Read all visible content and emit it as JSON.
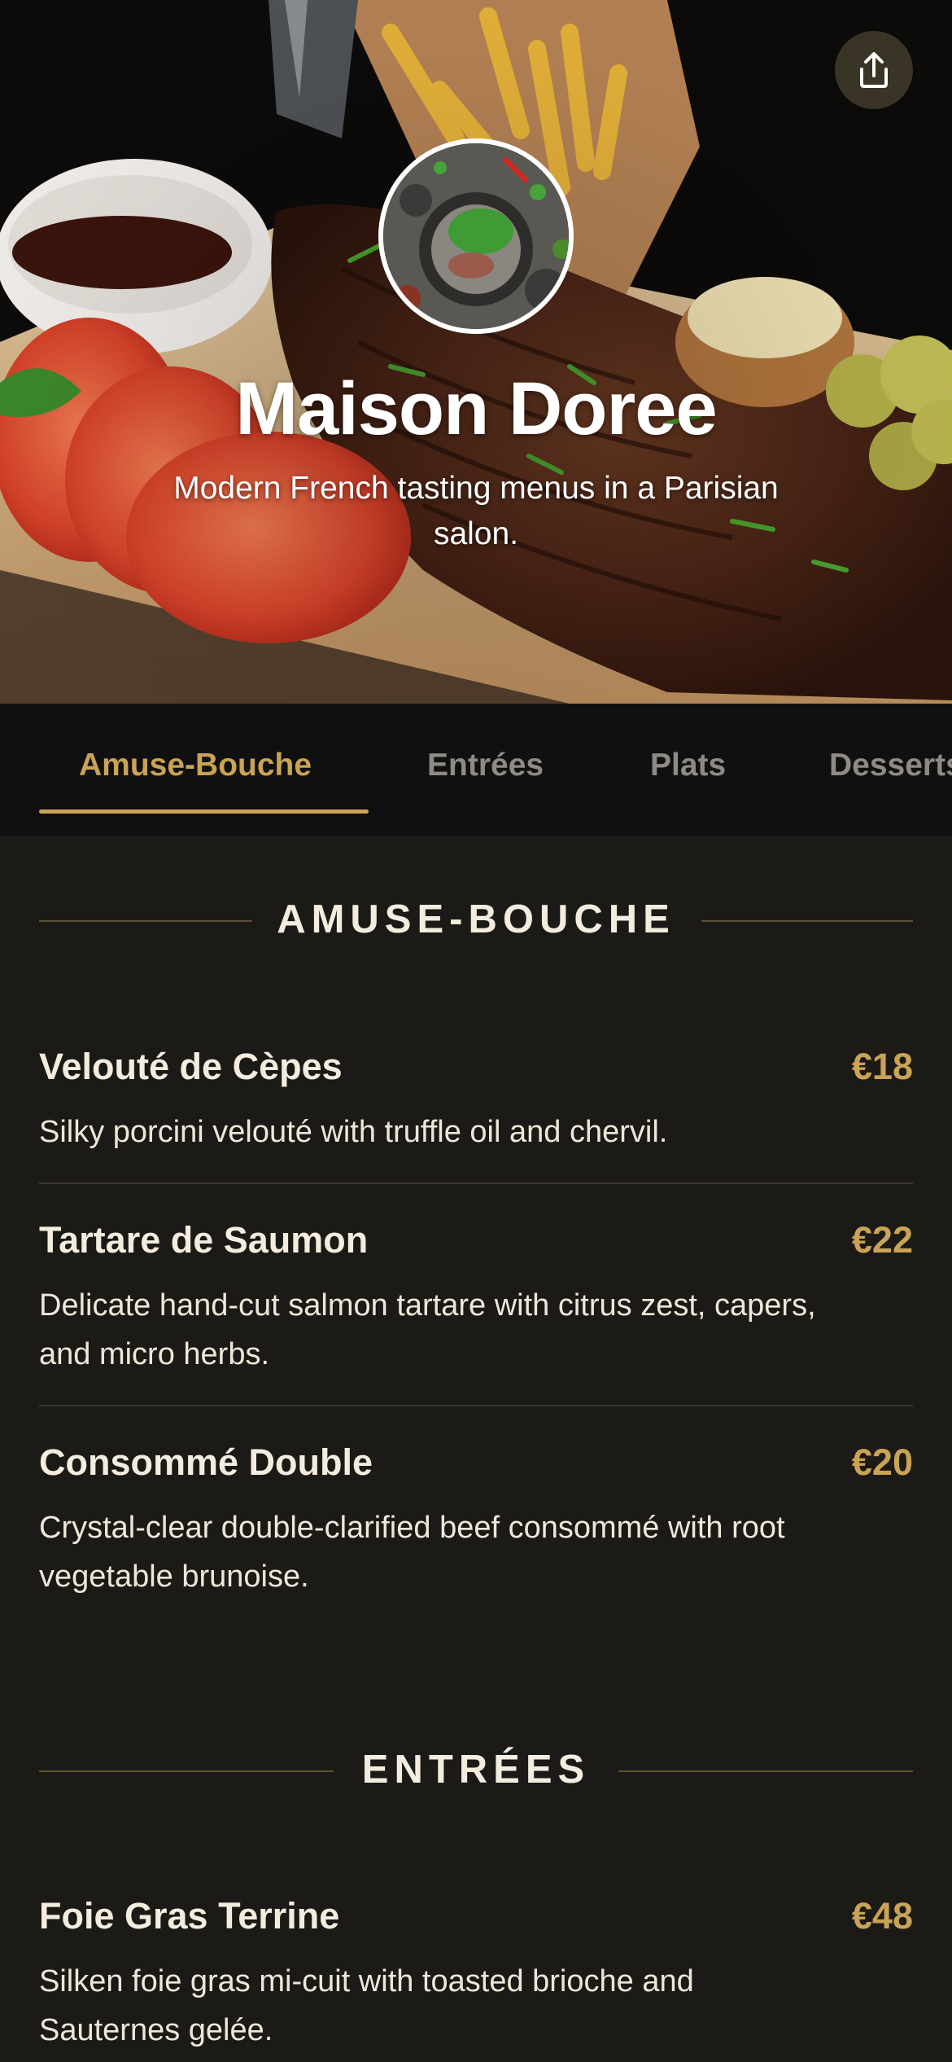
{
  "restaurant": {
    "name": "Maison Doree",
    "tagline": "Modern French tasting menus in a Parisian salon."
  },
  "header": {
    "share_icon": "share-icon",
    "avatar_image": "dish-plate-photo",
    "hero_image": "ribs-board-photo"
  },
  "tabs": [
    {
      "label": "Amuse-Bouche",
      "active": true
    },
    {
      "label": "Entrées",
      "active": false
    },
    {
      "label": "Plats",
      "active": false
    },
    {
      "label": "Desserts",
      "active": false
    }
  ],
  "sections": [
    {
      "title": "AMUSE-BOUCHE",
      "items": [
        {
          "name": "Velouté de Cèpes",
          "price": "€18",
          "description": "Silky porcini velouté with truffle oil and chervil."
        },
        {
          "name": "Tartare de Saumon",
          "price": "€22",
          "description": "Delicate hand-cut salmon tartare with citrus zest, capers, and micro herbs."
        },
        {
          "name": "Consommé Double",
          "price": "€20",
          "description": "Crystal-clear double-clarified beef consommé with root vegetable brunoise."
        }
      ]
    },
    {
      "title": "ENTRÉES",
      "items": [
        {
          "name": "Foie Gras Terrine",
          "price": "€48",
          "description": "Silken foie gras mi-cuit with toasted brioche and Sauternes gelée."
        }
      ]
    }
  ],
  "colors": {
    "accent_gold": "#c9a356",
    "background": "#1c1a17",
    "tab_bar": "#111010",
    "text_primary": "#f3ecdf",
    "text_muted": "#8e8a84"
  }
}
